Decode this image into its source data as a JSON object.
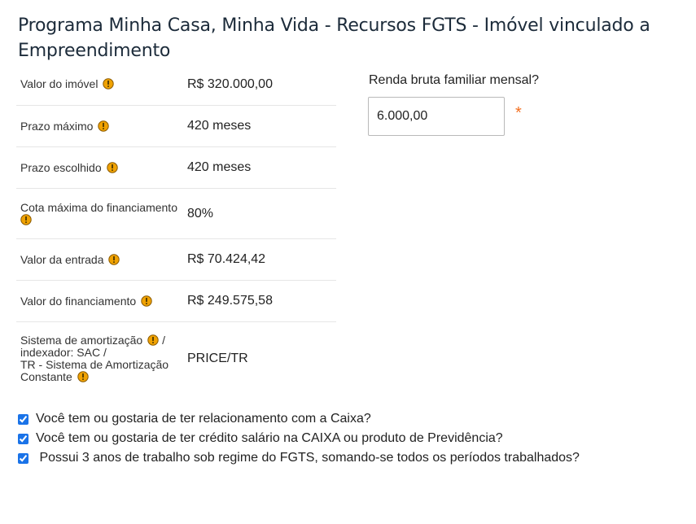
{
  "title": "Programa Minha Casa, Minha Vida - Recursos FGTS - Imóvel vinculado a Empreendimento",
  "details": [
    {
      "label": "Valor do imóvel",
      "value": "R$ 320.000,00"
    },
    {
      "label": "Prazo máximo",
      "value": "420 meses"
    },
    {
      "label": "Prazo escolhido",
      "value": "420 meses"
    },
    {
      "label": "Cota máxima do financiamento",
      "value": "80%"
    },
    {
      "label": "Valor da entrada",
      "value": "R$ 70.424,42"
    },
    {
      "label": "Valor do financiamento",
      "value": "R$ 249.575,58"
    },
    {
      "label_parts": [
        "Sistema de amortização",
        "/",
        "indexador: SAC /",
        "TR - Sistema de Amortização",
        "Constante"
      ],
      "value": "PRICE/TR"
    }
  ],
  "income": {
    "label": "Renda bruta familiar mensal?",
    "value": "6.000,00",
    "required_mark": "*"
  },
  "checkboxes": [
    {
      "label": "Você tem ou gostaria de ter relacionamento com a Caixa?",
      "checked": true
    },
    {
      "label": "Você tem ou gostaria de ter crédito salário na CAIXA ou produto de Previdência?",
      "checked": true
    },
    {
      "label": " Possui 3 anos de trabalho sob regime do FGTS, somando-se todos os períodos trabalhados?",
      "checked": true
    }
  ],
  "colors": {
    "warning_icon": "#f0a202",
    "required": "#f37021",
    "title": "#1c2b3a"
  }
}
